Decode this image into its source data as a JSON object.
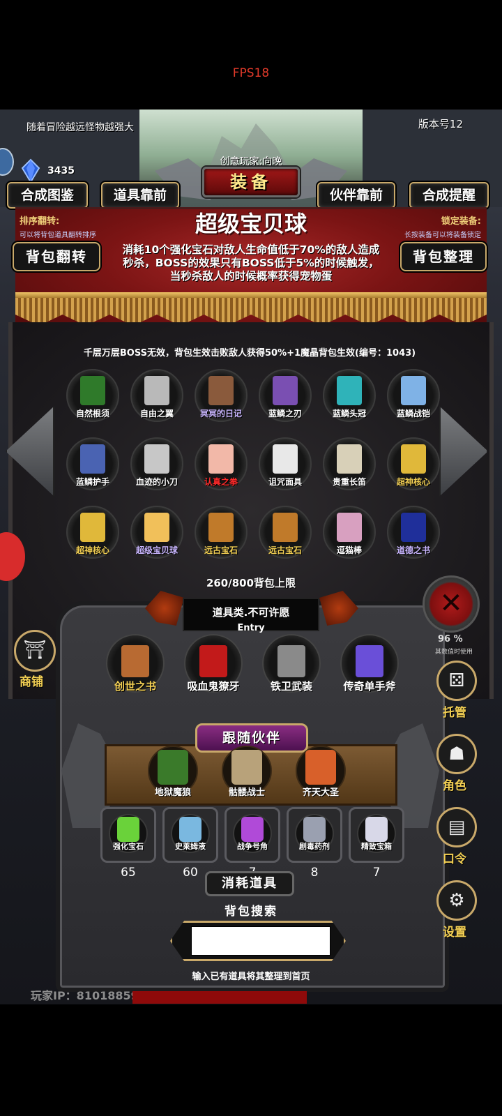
{
  "fps": "FPS18",
  "hint": "随着冒险越远怪物越强大",
  "version": "版本号12",
  "crystal_count": "3435",
  "creator": "创意玩家:向晚",
  "title": "装备",
  "nav": {
    "compendium": "合成图鉴",
    "items_front": "道具靠前",
    "partner_front": "伙伴靠前",
    "synth_remind": "合成提醒"
  },
  "sort": {
    "label": "排序翻转:",
    "hint": "可以将背包道具翻转排序"
  },
  "lock": {
    "label": "锁定装备:",
    "hint": "长按装备可以将装备锁定"
  },
  "selected_item": {
    "name": "超级宝贝球",
    "description": "消耗10个强化宝石对敌人生命值低于70%的敌人造成秒杀，BOSS的效果只有BOSS低于5%的时候触发，当秒杀敌人的时候概率获得宠物蛋"
  },
  "buttons": {
    "bag_flip": "背包翻转",
    "bag_sort": "背包整理"
  },
  "effect_note": "千层万层BOSS无效，背包生效击败敌人获得50%+1魔晶背包生效(编号：1043)",
  "inventory": [
    {
      "name": "自然根须",
      "color": "#2f7a2a",
      "name_color": "#ffffff"
    },
    {
      "name": "自由之翼",
      "color": "#b9b9b9",
      "name_color": "#ffffff"
    },
    {
      "name": "冥冥的日记",
      "color": "#8a5a3c",
      "name_color": "#c9b6ff"
    },
    {
      "name": "蓝鳞之刃",
      "color": "#7a4fb2",
      "name_color": "#ffffff"
    },
    {
      "name": "蓝鳞头冠",
      "color": "#2fb3b9",
      "name_color": "#ffffff"
    },
    {
      "name": "蓝鳞战铠",
      "color": "#7fb2e6",
      "name_color": "#ffffff"
    },
    {
      "name": "蓝鳞护手",
      "color": "#4a63b2",
      "name_color": "#ffffff"
    },
    {
      "name": "血迹的小刀",
      "color": "#c7c7c7",
      "name_color": "#ffffff"
    },
    {
      "name": "认真之拳",
      "color": "#f2b8a8",
      "name_color": "#ff2a2a"
    },
    {
      "name": "诅咒面具",
      "color": "#e8e8e8",
      "name_color": "#ffffff"
    },
    {
      "name": "贵重长笛",
      "color": "#d8d0b8",
      "name_color": "#ffffff"
    },
    {
      "name": "超神核心",
      "color": "#e0b83a",
      "name_color": "#f2cf54"
    },
    {
      "name": "超神核心",
      "color": "#e0b83a",
      "name_color": "#f2cf54"
    },
    {
      "name": "超级宝贝球",
      "color": "#f1c05a",
      "name_color": "#c9b6ff"
    },
    {
      "name": "远古宝石",
      "color": "#c07a2a",
      "name_color": "#f2cf54"
    },
    {
      "name": "远古宝石",
      "color": "#c07a2a",
      "name_color": "#f2cf54"
    },
    {
      "name": "逗猫棒",
      "color": "#d8a0c0",
      "name_color": "#ffffff"
    },
    {
      "name": "道德之书",
      "color": "#1f2f9a",
      "name_color": "#c9b6ff"
    }
  ],
  "bag_capacity": "260/800背包上限",
  "category": {
    "label": "道具类.不可许愿",
    "entry": "Entry"
  },
  "equipped": [
    {
      "name": "创世之书",
      "color": "#b86a32",
      "name_color": "#f2cf54"
    },
    {
      "name": "吸血鬼獠牙",
      "color": "#c21a1a",
      "name_color": "#ffffff"
    },
    {
      "name": "铁卫武装",
      "color": "#8a8a8a",
      "name_color": "#ffffff"
    },
    {
      "name": "传奇单手斧",
      "color": "#6a4fd8",
      "name_color": "#ffffff"
    }
  ],
  "partner_title": "跟随伙伴",
  "partners": [
    {
      "name": "地狱魔狼",
      "color": "#3a7a2a"
    },
    {
      "name": "骷髅战士",
      "color": "#b8a27a"
    },
    {
      "name": "齐天大圣",
      "color": "#d8602a"
    }
  ],
  "consumables": [
    {
      "name": "强化宝石",
      "count": "65",
      "color": "#6ad23a"
    },
    {
      "name": "史莱姆液",
      "count": "60",
      "color": "#7ab8e0"
    },
    {
      "name": "战争号角",
      "count": "7",
      "color": "#b04ad8"
    },
    {
      "name": "剧毒药剂",
      "count": "8",
      "color": "#9aa0b0"
    },
    {
      "name": "精致宝箱",
      "count": "7",
      "color": "#d8d8e8"
    }
  ],
  "consumables_title": "消耗道具",
  "search": {
    "label": "背包搜索",
    "value": "",
    "hint": "输入已有道具将其整理到首页"
  },
  "player_ip": "玩家IP：81018859",
  "close_glyph": "✕",
  "pct": "96 %",
  "pct_note": "其数值时使用",
  "shop_label": "商铺",
  "right_menu": [
    {
      "label": "托管",
      "icon": "dice-icon",
      "glyph": "⚄"
    },
    {
      "label": "角色",
      "icon": "hood-icon",
      "glyph": "☗"
    },
    {
      "label": "口令",
      "icon": "scroll-icon",
      "glyph": "▤"
    },
    {
      "label": "设置",
      "icon": "gear-icon",
      "glyph": "⚙"
    }
  ]
}
